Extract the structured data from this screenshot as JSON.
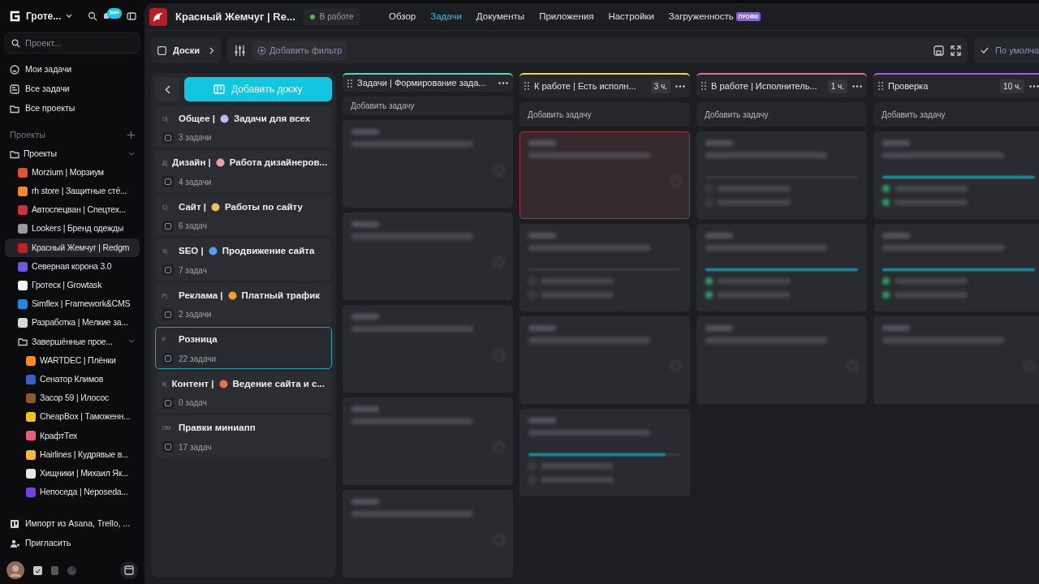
{
  "workspace": {
    "name": "Гроте...",
    "notifications": "99+"
  },
  "sidebar": {
    "search": {
      "placeholder": "Проект..."
    },
    "nav": [
      {
        "label": "Мои задачи",
        "kind": "smile"
      },
      {
        "label": "Все задачи",
        "kind": "tasks"
      },
      {
        "label": "Все проекты",
        "kind": "folder"
      }
    ],
    "section": "Проекты",
    "tree": [
      {
        "label": "Проекты",
        "kind": "folder",
        "expanded": true,
        "children": [
          {
            "label": "Morzium | Морзиум",
            "kind": "project",
            "color": "#e0533a",
            "selected": false
          },
          {
            "label": "rh store | Защитные стё...",
            "kind": "project",
            "color": "#f08a2c",
            "selected": false
          },
          {
            "label": "Автоспецван | Спецтех...",
            "kind": "project",
            "color": "#d0303a",
            "selected": false
          },
          {
            "label": "Lookers | Бренд одежды",
            "kind": "project",
            "color": "#9a9a9a",
            "selected": false
          },
          {
            "label": "Красный Жемчуг | Redgm",
            "kind": "project",
            "color": "#c41e2a",
            "selected": true
          },
          {
            "label": "Северная корона 3.0",
            "kind": "project",
            "color": "#6a5be0",
            "selected": false
          },
          {
            "label": "Гротеск | Growtask",
            "kind": "project",
            "color": "#f2f2f2",
            "selected": false
          },
          {
            "label": "Simflex | Framework&CMS",
            "kind": "project",
            "color": "#1e88e5",
            "selected": false
          },
          {
            "label": "Разработка | Мелкие за...",
            "kind": "project",
            "color": "#d8d8d8",
            "selected": false
          },
          {
            "label": "Завершённые прое...",
            "kind": "folder",
            "expanded": true,
            "children": [
              {
                "label": "WARTDEC | Плёнки",
                "kind": "project",
                "color": "#ff8a1c",
                "selected": false
              },
              {
                "label": "Сенатор Климов",
                "kind": "project",
                "color": "#3a5fc8",
                "selected": false
              },
              {
                "label": "Засор 59 | Илосос",
                "kind": "project",
                "color": "#8a5a2e",
                "selected": false
              },
              {
                "label": "CheapBox | Таможенн...",
                "kind": "project",
                "color": "#f2c21c",
                "selected": false
              },
              {
                "label": "КрафтТех",
                "kind": "project",
                "color": "#f05a7e",
                "selected": false
              },
              {
                "label": "Hairlines | Кудрявые в...",
                "kind": "project",
                "color": "#f5b83a",
                "selected": false
              },
              {
                "label": "Хищники | Михаил Як...",
                "kind": "project",
                "color": "#e8e8e8",
                "selected": false
              },
              {
                "label": "Непоседа | Neposeda...",
                "kind": "project",
                "color": "#7a3fe0",
                "selected": false
              }
            ]
          }
        ]
      }
    ],
    "footer_links": [
      {
        "label": "Импорт из Asana, Trello, ...",
        "kind": "import"
      },
      {
        "label": "Пригласить",
        "kind": "invite"
      }
    ]
  },
  "project": {
    "title": "Красный Жемчуг | Re...",
    "status": "В работе"
  },
  "tabs": [
    {
      "label": "Обзор",
      "selected": false
    },
    {
      "label": "Задачи",
      "selected": true
    },
    {
      "label": "Документы",
      "selected": false
    },
    {
      "label": "Приложения",
      "selected": false
    },
    {
      "label": "Настройки",
      "selected": false
    },
    {
      "label": "Загруженность",
      "selected": false,
      "badge": "ПРОФИ"
    }
  ],
  "toolbar": {
    "boards": "Доски",
    "filter": "Добавить фильтр",
    "view": "По умолча"
  },
  "boards_panel": {
    "add": "Добавить доску",
    "boards": [
      {
        "abbr": "О|",
        "name": "Общее |",
        "color": "#c9b3f0",
        "title": "Задачи для всех",
        "count": "3 задачи",
        "selected": false
      },
      {
        "abbr": "Д|",
        "name": "Дизайн |",
        "color": "#e8a0a8",
        "title": "Работа дизайнеров...",
        "count": "4 задачи",
        "selected": false
      },
      {
        "abbr": "С|",
        "name": "Сайт |",
        "color": "#f0c060",
        "title": "Работы по сайту",
        "count": "6 задач",
        "selected": false
      },
      {
        "abbr": "S|",
        "name": "SEO |",
        "color": "#5aa0f0",
        "title": "Продвижение сайта",
        "count": "7 задач",
        "selected": false
      },
      {
        "abbr": "Р|",
        "name": "Реклама |",
        "color": "#f0a030",
        "title": "Платный трафик",
        "count": "2 задачи",
        "selected": false
      },
      {
        "abbr": "Р",
        "name": "Розница",
        "count": "22 задачи",
        "selected": true
      },
      {
        "abbr": "К|",
        "name": "Контент |",
        "color": "#f07040",
        "title": "Ведение сайта и с...",
        "count": "0 задач",
        "selected": false
      },
      {
        "abbr": "ПМ",
        "name": "Правки миниапп",
        "count": "17 задач",
        "selected": false
      }
    ]
  },
  "columns": [
    {
      "title": "Задачи | Формирование зада...",
      "color": "#4fd8c8",
      "add": "Добавить задачу",
      "cards": [
        {
          "kind": "task",
          "highlighted": false
        },
        {
          "kind": "task",
          "highlighted": false
        },
        {
          "kind": "task",
          "highlighted": false
        },
        {
          "kind": "task",
          "highlighted": false
        },
        {
          "kind": "task",
          "highlighted": false
        }
      ]
    },
    {
      "title": "К работе | Есть исполн...",
      "hours": "3 ч.",
      "color": "#f2d64a",
      "add": "Добавить задачу",
      "cards": [
        {
          "kind": "task",
          "highlighted": true
        },
        {
          "kind": "checklist",
          "highlighted": false,
          "level": 0
        },
        {
          "kind": "task",
          "highlighted": false
        },
        {
          "kind": "checklist",
          "highlighted": false,
          "level": 0.9
        }
      ]
    },
    {
      "title": "В работе | Исполнитель...",
      "hours": "1 ч.",
      "color": "#e86aa0",
      "add": "Добавить задачу",
      "cards": [
        {
          "kind": "checklist",
          "highlighted": false,
          "level": 0
        },
        {
          "kind": "checklist",
          "highlighted": false,
          "level": 1
        },
        {
          "kind": "task",
          "highlighted": false
        }
      ]
    },
    {
      "title": "Проверка",
      "hours": "10 ч.",
      "color": "#a85af0",
      "add": "Добавить задачу",
      "cards": [
        {
          "kind": "checklist",
          "highlighted": false,
          "level": 1
        },
        {
          "kind": "checklist",
          "highlighted": false,
          "level": 1
        },
        {
          "kind": "task",
          "highlighted": false
        }
      ]
    }
  ]
}
